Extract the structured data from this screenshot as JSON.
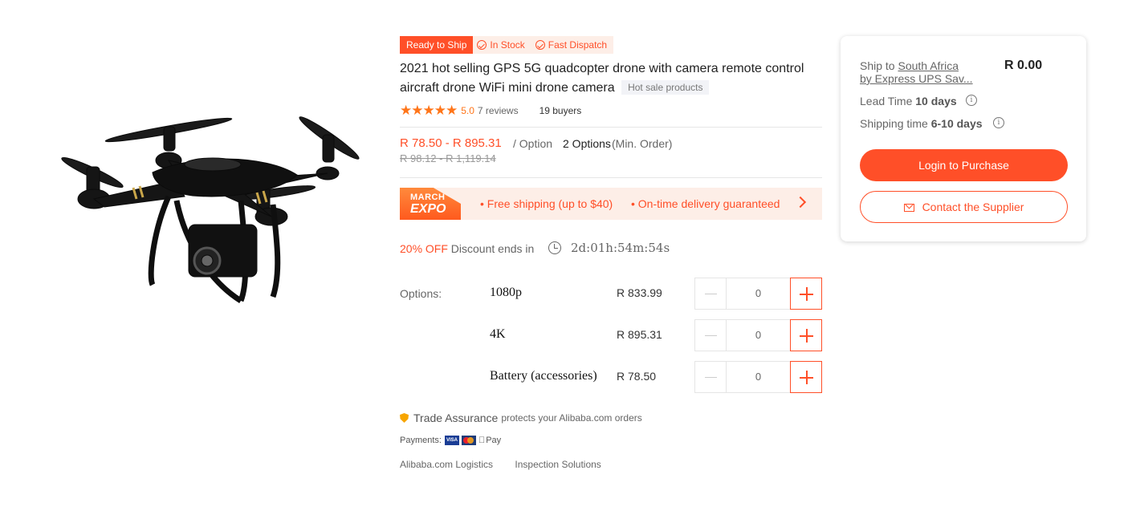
{
  "product": {
    "badges": {
      "ready": "Ready to Ship",
      "stock": "In Stock",
      "dispatch": "Fast Dispatch"
    },
    "title": "2021 hot selling GPS 5G quadcopter drone with camera remote control aircraft drone WiFi mini drone camera",
    "hot_tag": "Hot sale products",
    "rating": {
      "stars": "★★★★★",
      "score": "5.0",
      "reviews": "7 reviews",
      "buyers": "19 buyers"
    },
    "price": {
      "range": "R 78.50 - R 895.31",
      "per": "/ Option",
      "min_count": "2 Options",
      "min_label": "(Min. Order)",
      "original": "R 98.12 - R 1,119.14"
    },
    "expo": {
      "logo_line1": "MARCH",
      "logo_line2": "EXPO",
      "benefit1": "• Free shipping (up to $40)",
      "benefit2": "• On-time delivery guaranteed"
    },
    "discount": {
      "off": "20% OFF",
      "text": "Discount ends in",
      "countdown": "2d:01h:54m:54s"
    },
    "options_label": "Options:",
    "options": [
      {
        "name": "1080p",
        "price": "R 833.99",
        "qty": "0"
      },
      {
        "name": "4K",
        "price": "R 895.31",
        "qty": "0"
      },
      {
        "name": "Battery (accessories)",
        "price": "R 78.50",
        "qty": "0"
      }
    ],
    "trade": {
      "name": "Trade Assurance",
      "text": "protects your Alibaba.com orders"
    },
    "payments": {
      "label": "Payments:",
      "visa": "VISA",
      "apple_pay": "Pay"
    },
    "links": {
      "logistics": "Alibaba.com Logistics",
      "inspection": "Inspection Solutions"
    }
  },
  "purchase_card": {
    "ship_prefix": "Ship to ",
    "ship_country": "South Africa",
    "ship_method": "by Express UPS Sav...",
    "ship_price": "R 0.00",
    "lead_label": "Lead Time ",
    "lead_value": "10 days",
    "shipping_label": "Shipping time ",
    "shipping_value": "6-10 days",
    "info_glyph": "i",
    "login_button": "Login to Purchase",
    "contact_button": "Contact the Supplier"
  },
  "colors": {
    "accent": "#ff4f28",
    "star": "#ff7519",
    "expo_bg": "#fdeee7"
  },
  "icons": [
    "check-circle-icon",
    "star-icon",
    "chevron-right-icon",
    "clock-icon",
    "minus-icon",
    "plus-icon",
    "shield-icon",
    "visa-icon",
    "mastercard-icon",
    "apple-pay-icon",
    "info-icon",
    "mail-icon"
  ]
}
